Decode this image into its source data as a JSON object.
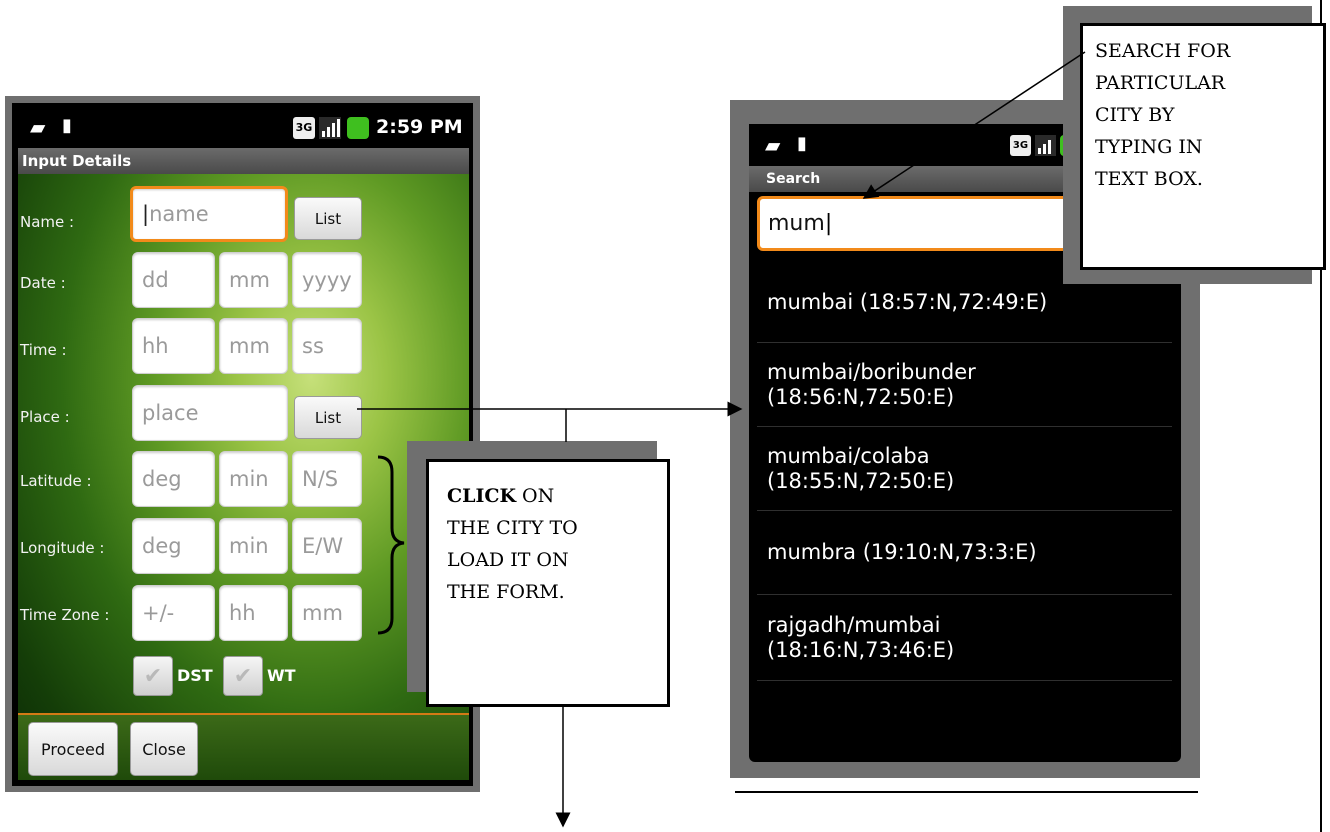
{
  "phone_left": {
    "status": {
      "time": "2:59 PM",
      "icons": [
        "chat-icon",
        "sd-card-icon",
        "3g-icon",
        "signal-icon",
        "battery-icon"
      ]
    },
    "title": "Input Details",
    "rows": [
      {
        "label": "Name :",
        "fields": [
          "name"
        ],
        "button": "List"
      },
      {
        "label": "Date :",
        "fields": [
          "dd",
          "mm",
          "yyyy"
        ]
      },
      {
        "label": "Time :",
        "fields": [
          "hh",
          "mm",
          "ss"
        ]
      },
      {
        "label": "Place :",
        "fields": [
          "place"
        ],
        "button": "List"
      },
      {
        "label": "Latitude :",
        "fields": [
          "deg",
          "min",
          "N/S"
        ]
      },
      {
        "label": "Longitude :",
        "fields": [
          "deg",
          "min",
          "E/W"
        ]
      },
      {
        "label": "Time Zone :",
        "fields": [
          "+/-",
          "hh",
          "mm"
        ]
      }
    ],
    "checkboxes": [
      "DST",
      "WT"
    ],
    "buttons": {
      "proceed": "Proceed",
      "close": "Close"
    }
  },
  "phone_right": {
    "title": "Search",
    "search_value": "mum",
    "results": [
      {
        "line1": "mumbai (18:57:N,72:49:E)",
        "line2": ""
      },
      {
        "line1": "mumbai/boribunder",
        "line2": "(18:56:N,72:50:E)"
      },
      {
        "line1": "mumbai/colaba",
        "line2": "(18:55:N,72:50:E)"
      },
      {
        "line1": "mumbra (19:10:N,73:3:E)",
        "line2": ""
      },
      {
        "line1": "rajgadh/mumbai",
        "line2": "(18:16:N,73:46:E)"
      }
    ]
  },
  "callouts": {
    "search": [
      "SEARCH FOR",
      "PARTICULAR",
      "CITY BY",
      "TYPING IN",
      "TEXT BOX."
    ],
    "click_bold": "CLICK",
    "click_rest": [
      " ON",
      "THE CITY TO",
      "LOAD IT ON",
      "THE FORM."
    ]
  }
}
